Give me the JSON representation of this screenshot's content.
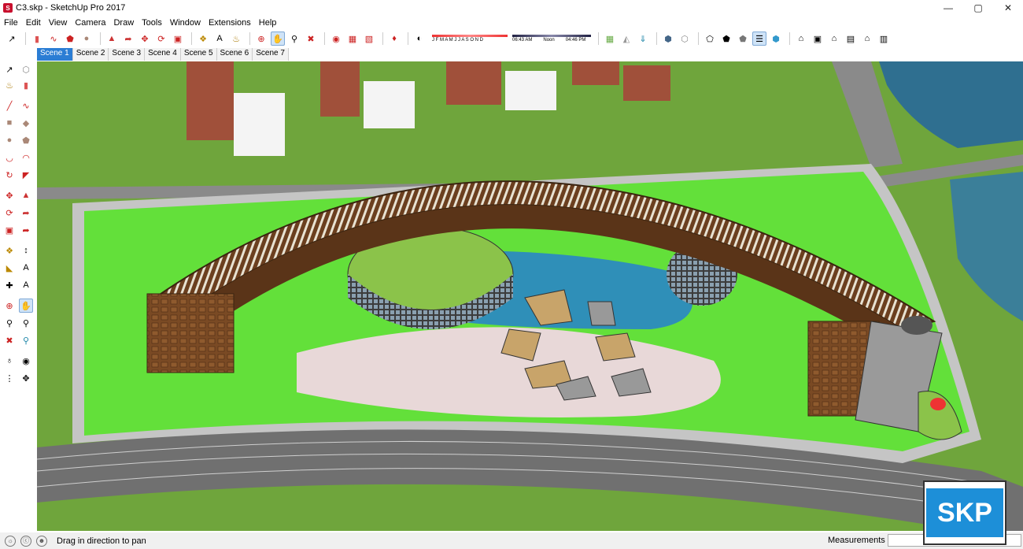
{
  "window": {
    "title": "C3.skp - SketchUp Pro 2017",
    "app_icon": "sketchup-icon"
  },
  "menu": [
    "File",
    "Edit",
    "View",
    "Camera",
    "Draw",
    "Tools",
    "Window",
    "Extensions",
    "Help"
  ],
  "shadow": {
    "months": "J F M A M J J A S O N D",
    "time_start": "06:43 AM",
    "time_mid": "Noon",
    "time_end": "04:46 PM"
  },
  "scenes": [
    "Scene 1",
    "Scene 2",
    "Scene 3",
    "Scene 4",
    "Scene 5",
    "Scene 6",
    "Scene 7"
  ],
  "active_scene": "Scene 1",
  "status": {
    "hint": "Drag in direction to pan",
    "measurements_label": "Measurements",
    "measurements_value": ""
  },
  "watermark": {
    "text": "SKP"
  },
  "colors": {
    "accent": "#2b7dd4",
    "grass": "#6fa53c",
    "building_brown": "#7a4a24",
    "water": "#2f7fa5",
    "road": "#7c7c7c"
  }
}
